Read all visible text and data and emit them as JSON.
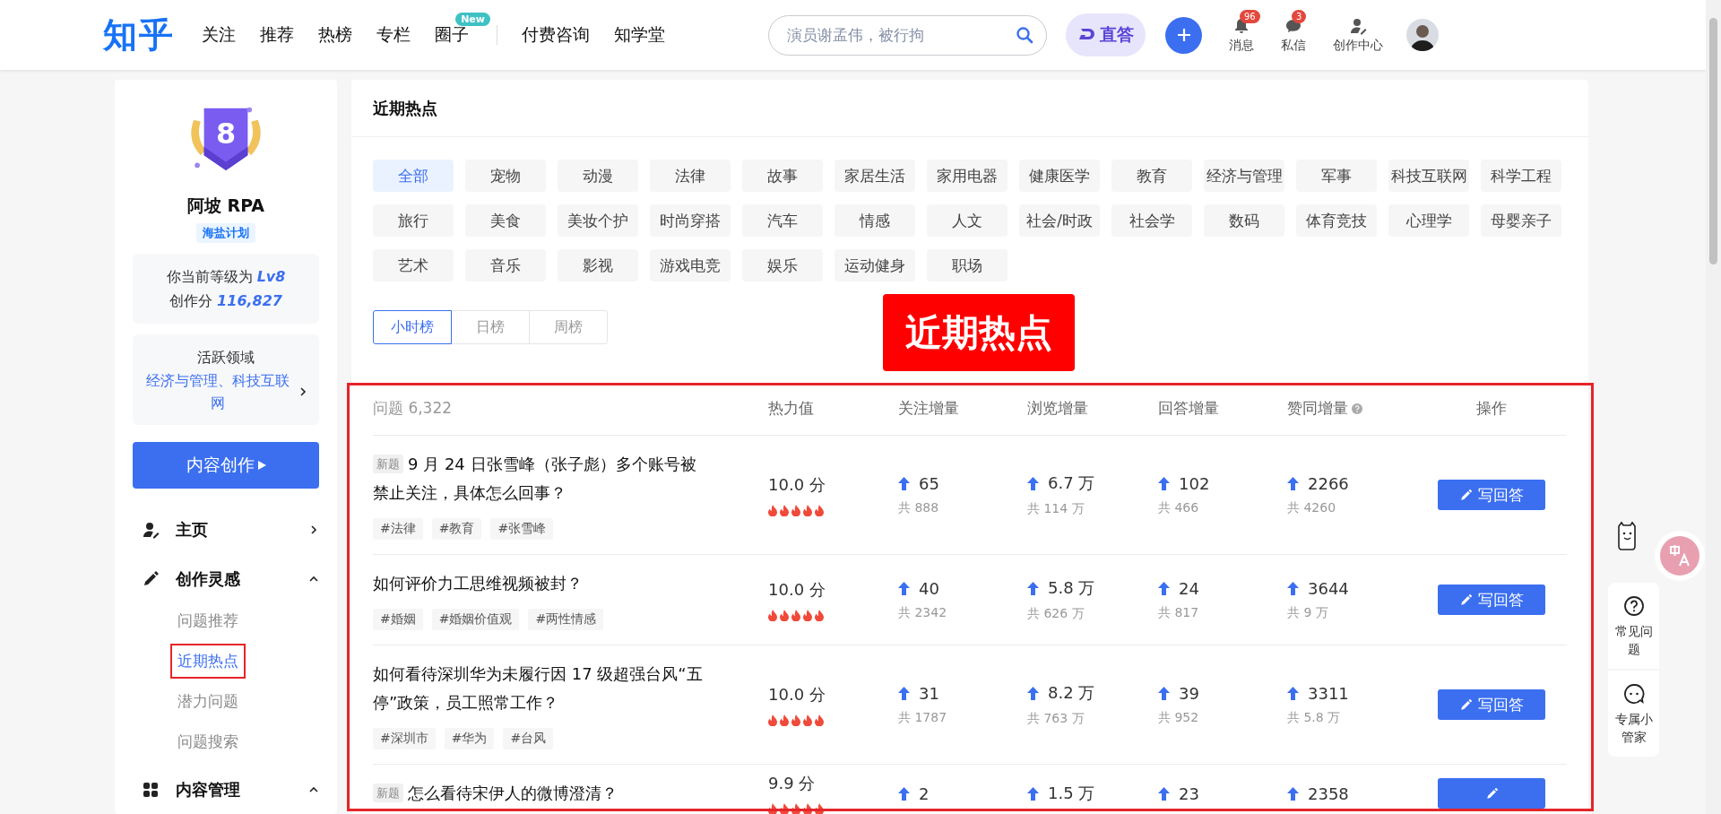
{
  "header": {
    "logo": "知乎",
    "nav": [
      {
        "label": "关注"
      },
      {
        "label": "推荐"
      },
      {
        "label": "热榜"
      },
      {
        "label": "专栏"
      },
      {
        "label": "圈子",
        "badge": "New"
      }
    ],
    "nav_extra": [
      {
        "label": "付费咨询"
      },
      {
        "label": "知学堂"
      }
    ],
    "search": {
      "placeholder": "演员谢孟伟，被行拘"
    },
    "ai_button": {
      "label": "直答"
    },
    "actions": [
      {
        "kind": "bell",
        "label": "消息",
        "badge": "96"
      },
      {
        "kind": "chat",
        "label": "私信",
        "badge": "3"
      },
      {
        "kind": "creator",
        "label": "创作中心"
      }
    ]
  },
  "sidebar": {
    "level_badge": "8",
    "name": "阿坡 RPA",
    "plan": "海盐计划",
    "level_label": "你当前等级为",
    "level": "Lv8",
    "score_label": "创作分",
    "score": "116,827",
    "fields_label": "活跃领域",
    "fields": "经济与管理、科技互联网",
    "create_button": "内容创作",
    "menu": [
      {
        "kind": "home",
        "label": "主页",
        "expanded": false
      },
      {
        "kind": "pen",
        "label": "创作灵感",
        "expanded": true,
        "children": [
          {
            "label": "问题推荐",
            "selected": false
          },
          {
            "label": "近期热点",
            "selected": true
          },
          {
            "label": "潜力问题",
            "selected": false
          },
          {
            "label": "问题搜索",
            "selected": false
          }
        ]
      },
      {
        "kind": "grid",
        "label": "内容管理",
        "expanded": true
      }
    ]
  },
  "main": {
    "title": "近期热点",
    "categories": [
      {
        "label": "全部",
        "selected": true
      },
      {
        "label": "宠物",
        "selected": false
      },
      {
        "label": "动漫",
        "selected": false
      },
      {
        "label": "法律",
        "selected": false
      },
      {
        "label": "故事",
        "selected": false
      },
      {
        "label": "家居生活",
        "selected": false
      },
      {
        "label": "家用电器",
        "selected": false
      },
      {
        "label": "健康医学",
        "selected": false
      },
      {
        "label": "教育",
        "selected": false
      },
      {
        "label": "经济与管理",
        "selected": false
      },
      {
        "label": "军事",
        "selected": false
      },
      {
        "label": "科技互联网",
        "selected": false
      },
      {
        "label": "科学工程",
        "selected": false
      },
      {
        "label": "旅行",
        "selected": false
      },
      {
        "label": "美食",
        "selected": false
      },
      {
        "label": "美妆个护",
        "selected": false
      },
      {
        "label": "时尚穿搭",
        "selected": false
      },
      {
        "label": "汽车",
        "selected": false
      },
      {
        "label": "情感",
        "selected": false
      },
      {
        "label": "人文",
        "selected": false
      },
      {
        "label": "社会/时政",
        "selected": false
      },
      {
        "label": "社会学",
        "selected": false
      },
      {
        "label": "数码",
        "selected": false
      },
      {
        "label": "体育竞技",
        "selected": false
      },
      {
        "label": "心理学",
        "selected": false
      },
      {
        "label": "母婴亲子",
        "selected": false
      },
      {
        "label": "艺术",
        "selected": false
      },
      {
        "label": "音乐",
        "selected": false
      },
      {
        "label": "影视",
        "selected": false
      },
      {
        "label": "游戏电竞",
        "selected": false
      },
      {
        "label": "娱乐",
        "selected": false
      },
      {
        "label": "运动健身",
        "selected": false
      },
      {
        "label": "职场",
        "selected": false
      }
    ],
    "rank_tabs": [
      {
        "label": "小时榜",
        "selected": true
      },
      {
        "label": "日榜",
        "selected": false
      },
      {
        "label": "周榜",
        "selected": false
      }
    ],
    "annotation": "近期热点",
    "table": {
      "columns": [
        {
          "label": "问题 6,322"
        },
        {
          "label": "热力值"
        },
        {
          "label": "关注增量"
        },
        {
          "label": "浏览增量"
        },
        {
          "label": "回答增量"
        },
        {
          "label": "赞同增量",
          "help": true
        },
        {
          "label": "操作"
        }
      ],
      "rows": [
        {
          "new_tag": "新题",
          "title": "9 月 24 日张雪峰（张子彪）多个账号被禁止关注，具体怎么回事？",
          "tags": [
            "#法律",
            "#教育",
            "#张雪峰"
          ],
          "heat": "10.0 分",
          "stats": [
            {
              "value": "65",
              "total": "共 888"
            },
            {
              "value": "6.7 万",
              "total": "共 114 万"
            },
            {
              "value": "102",
              "total": "共 466"
            },
            {
              "value": "2266",
              "total": "共 4260"
            }
          ],
          "action": "写回答"
        },
        {
          "title": "如何评价力工思维视频被封？",
          "tags": [
            "#婚姻",
            "#婚姻价值观",
            "#两性情感"
          ],
          "heat": "10.0 分",
          "stats": [
            {
              "value": "40",
              "total": "共 2342"
            },
            {
              "value": "5.8 万",
              "total": "共 626 万"
            },
            {
              "value": "24",
              "total": "共 817"
            },
            {
              "value": "3644",
              "total": "共 9 万"
            }
          ],
          "action": "写回答"
        },
        {
          "title": "如何看待深圳华为未履行因 17 级超强台风“五停”政策，员工照常工作？",
          "tags": [
            "#深圳市",
            "#华为",
            "#台风"
          ],
          "heat": "10.0 分",
          "stats": [
            {
              "value": "31",
              "total": "共 1787"
            },
            {
              "value": "8.2 万",
              "total": "共 763 万"
            },
            {
              "value": "39",
              "total": "共 952"
            },
            {
              "value": "3311",
              "total": "共 5.8 万"
            }
          ],
          "action": "写回答"
        },
        {
          "new_tag": "新题",
          "title": "怎么看待宋伊人的微博澄清？",
          "heat": "9.9 分",
          "stats": [
            {
              "value": "2"
            },
            {
              "value": "1.5 万"
            },
            {
              "value": "23"
            },
            {
              "value": "2358"
            }
          ]
        }
      ]
    }
  },
  "float_panel": [
    {
      "kind": "help",
      "label": "常见问题"
    },
    {
      "kind": "chat",
      "label": "专属小管家"
    }
  ]
}
